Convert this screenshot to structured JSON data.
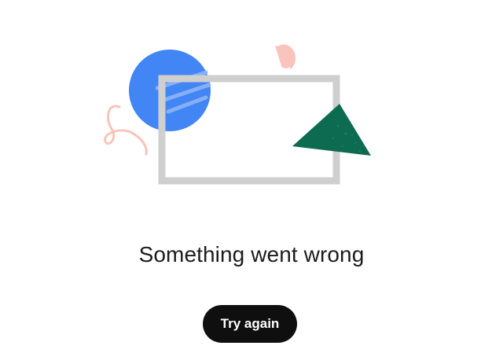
{
  "error": {
    "message": "Something went wrong",
    "retry_label": "Try again"
  },
  "colors": {
    "blue_circle": "#4285f4",
    "pink_accent": "#f8c4bb",
    "green_triangle": "#0d6b52",
    "frame_gray": "#cfcfcf",
    "button_bg": "#0f0f0f",
    "button_text": "#ffffff"
  }
}
